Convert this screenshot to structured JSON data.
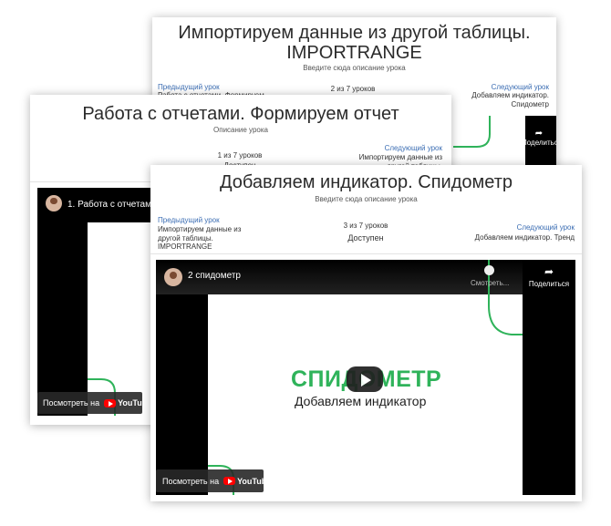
{
  "colors": {
    "link": "#3b6db3",
    "brand_green": "#2fb35a",
    "youtube_red": "#ff0000"
  },
  "card_back": {
    "title_line1": "Импортируем данные из другой таблицы.",
    "title_line2": "IMPORTRANGE",
    "description": "Введите сюда описание урока",
    "prev_label": "Предыдущий урок",
    "prev_title": "Работа с отчетами. Формируем",
    "counter": "2 из 7 уроков",
    "next_label": "Следующий урок",
    "next_title_line1": "Добавляем индикатор.",
    "next_title_line2": "Спидометр",
    "share_label": "Поделиться"
  },
  "card_middle": {
    "title": "Работа с отчетами. Формируем отчет",
    "description": "Описание урока",
    "counter": "1 из 7 уроков",
    "status": "Доступен",
    "next_label": "Следующий урок",
    "next_title_line1": "Импортируем данные из",
    "next_title_line2": "другой таблицы.",
    "video_title": "1. Работа с отчетами",
    "watch_on": "Посмотреть на",
    "youtube": "YouTube"
  },
  "card_front": {
    "title": "Добавляем индикатор. Спидометр",
    "description": "Введите сюда описание урока",
    "prev_label": "Предыдущий урок",
    "prev_title_line1": "Импортируем данные из",
    "prev_title_line2": "другой таблицы.",
    "prev_title_line3": "IMPORTRANGE",
    "counter": "3 из 7 уроков",
    "status": "Доступен",
    "next_label": "Следующий урок",
    "next_title": "Добавляем индикатор. Тренд",
    "video_title": "2 спидометр",
    "watch_later": "Смотреть...",
    "share_label": "Поделиться",
    "slide_heading": "СПИДОМЕТР",
    "slide_subheading": "Добавляем индикатор",
    "watch_on": "Посмотреть на",
    "youtube": "YouTube"
  }
}
